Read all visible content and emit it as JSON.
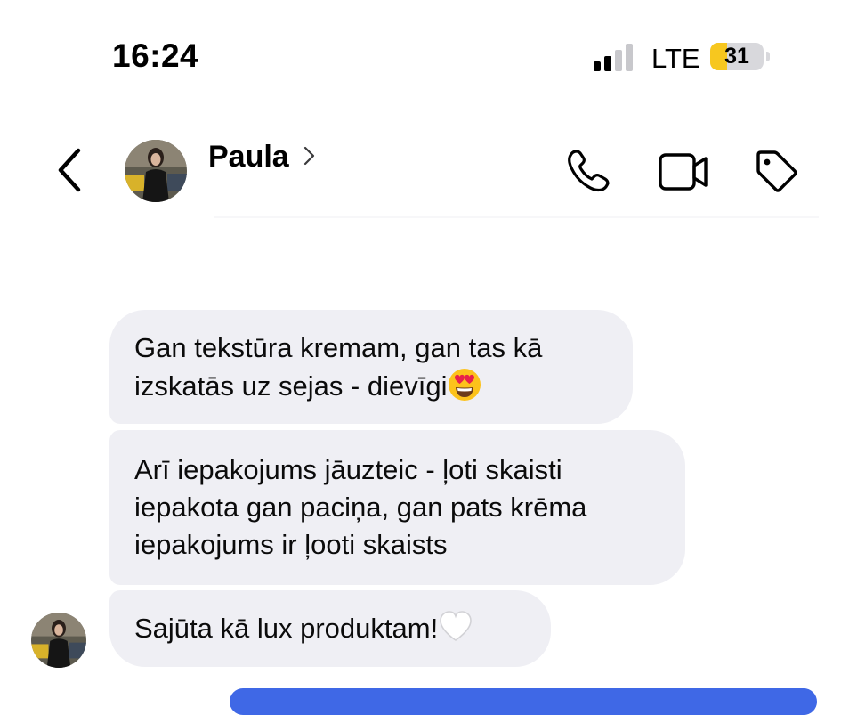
{
  "status_bar": {
    "time": "16:24",
    "network": "LTE",
    "battery_level": "31",
    "battery_fraction": 0.31,
    "signal_bars_active": 2,
    "signal_bars_total": 4
  },
  "header": {
    "contact_name": "Paula",
    "icons": [
      "back-chevron-icon",
      "phone-icon",
      "video-camera-icon",
      "tag-icon"
    ]
  },
  "messages": [
    {
      "lines": [
        "Gan tekstūra kremam, gan tas kā",
        "izskatās uz sejas - dievīgi"
      ],
      "emoji": "heart-eyes-emoji"
    },
    {
      "lines": [
        "Arī iepakojums jāuzteic - ļoti skaisti",
        "iepakota gan paciņa, gan pats krēma",
        "iepakojums ir ļooti skaists"
      ]
    },
    {
      "lines": [
        "Sajūta kā lux produktam!"
      ],
      "emoji": "white-heart-emoji"
    }
  ],
  "colors": {
    "incoming_bubble": "#efeff4",
    "outgoing_bubble": "#3f68e6",
    "battery_fill": "#f7c71f"
  }
}
